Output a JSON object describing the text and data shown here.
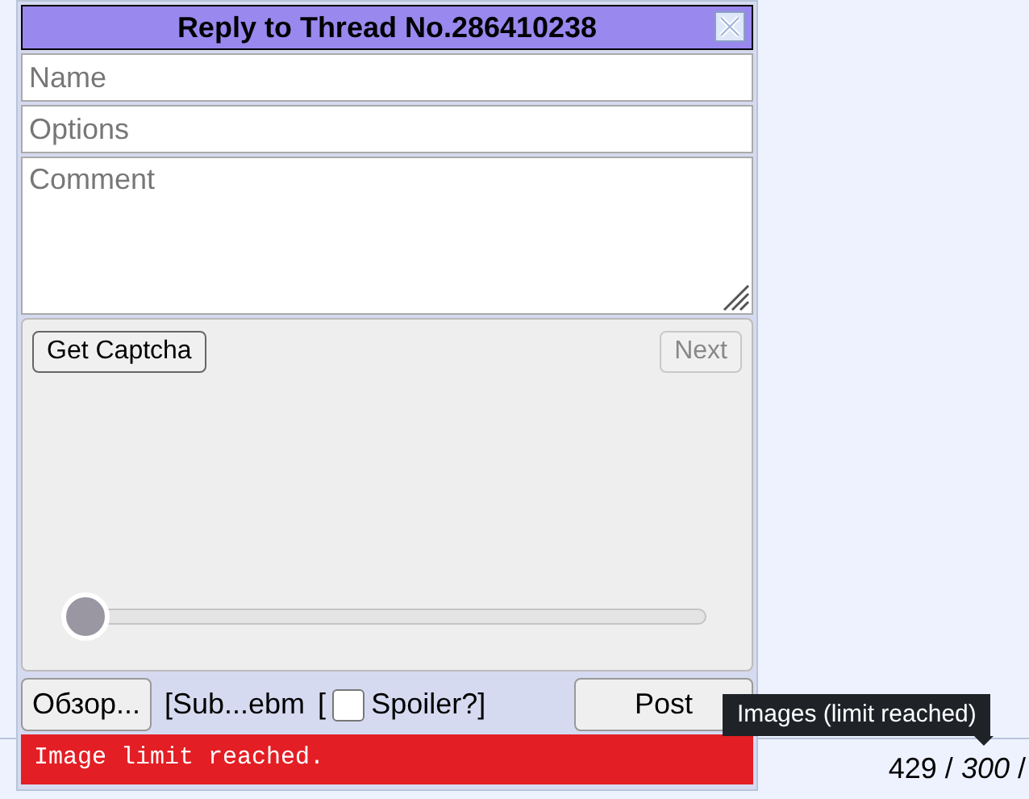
{
  "reply_form": {
    "title": "Reply to Thread No.286410238",
    "fields": [
      {
        "kind": "input",
        "placeholder": "Name"
      },
      {
        "kind": "input",
        "placeholder": "Options"
      },
      {
        "kind": "textarea",
        "placeholder": "Comment"
      }
    ],
    "captcha": {
      "get_button": "Get Captcha",
      "next_button": {
        "label": "Next",
        "disabled": true
      },
      "slider": {
        "level": 0
      }
    },
    "file_button": "Обзор...",
    "file_name": "[Sub...ebm",
    "bracket_open": "[",
    "spoiler": {
      "label": "Spoiler?]",
      "checked": false
    },
    "post_button": "Post",
    "error": "Image limit reached."
  },
  "tooltip": "Images (limit reached)",
  "counter": {
    "replies": "429",
    "separator": "/",
    "images": "300",
    "trailing": "/"
  }
}
